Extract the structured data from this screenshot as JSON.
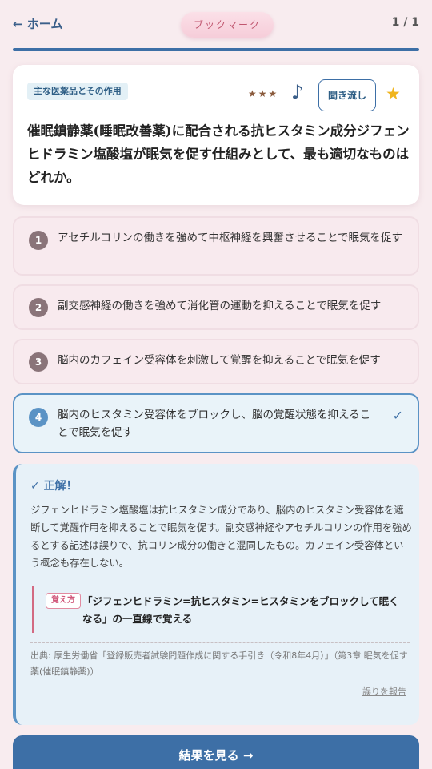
{
  "header": {
    "back_label": "← ホーム",
    "bookmark_label": "ブックマーク",
    "counter": "1 / 1"
  },
  "progress": 1.0,
  "question": {
    "category": "主な医薬品とその作用",
    "difficulty": "★★★",
    "audio_icon": "♪",
    "listen_label": "聞き流し",
    "favorite_icon": "★",
    "text": "催眠鎮静薬(睡眠改善薬)に配合される抗ヒスタミン成分ジフェンヒドラミン塩酸塩が眠気を促す仕組みとして、最も適切なものはどれか。"
  },
  "options": [
    {
      "num": "1",
      "text": "アセチルコリンの働きを強めて中枢神経を興奮させることで眠気を促す"
    },
    {
      "num": "2",
      "text": "副交感神経の働きを強めて消化管の運動を抑えることで眠気を促す"
    },
    {
      "num": "3",
      "text": "脳内のカフェイン受容体を刺激して覚醒を抑えることで眠気を促す"
    },
    {
      "num": "4",
      "text": "脳内のヒスタミン受容体をブロックし、脳の覚醒状態を抑えることで眠気を促す",
      "mark": "✓"
    }
  ],
  "explanation": {
    "title": "✓ 正解！",
    "body": "ジフェンヒドラミン塩酸塩は抗ヒスタミン成分であり、脳内のヒスタミン受容体を遮断して覚醒作用を抑えることで眠気を促す。副交感神経やアセチルコリンの作用を強めるとする記述は誤りで、抗コリン成分の働きと混同したもの。カフェイン受容体という概念も存在しない。",
    "memo_tag": "覚え方",
    "memo_text": "「ジフェンヒドラミン=抗ヒスタミン=ヒスタミンをブロックして眠くなる」の一直線で覚える",
    "source": "出典: 厚生労働省「登録販売者試験問題作成に関する手引き（令和8年4月）」（第3章 眠気を促す薬(催眠鎮静薬)）",
    "report_label": "誤りを報告"
  },
  "result_button": "結果を見る →",
  "colors": {
    "accent": "#3d6fa6",
    "correct_border": "#5b93c5",
    "background": "#f8ecef",
    "star": "#f0b51e"
  }
}
